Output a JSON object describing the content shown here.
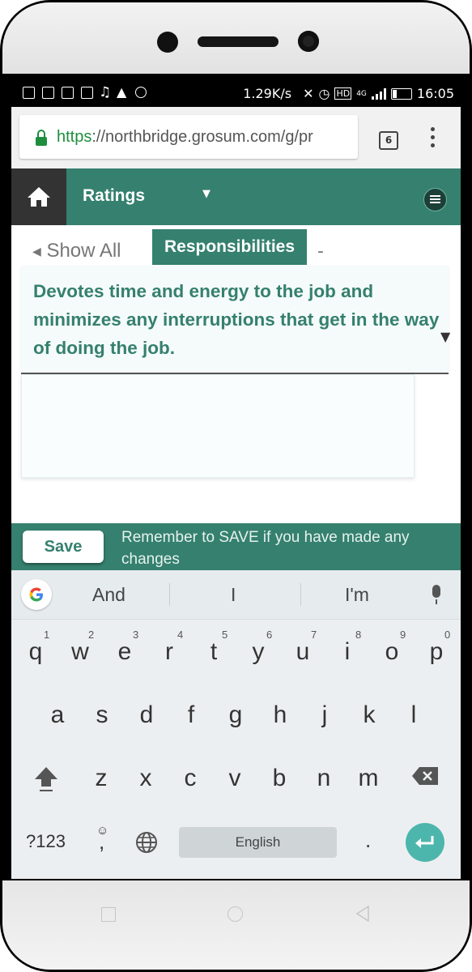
{
  "status_bar": {
    "net_speed": "1.29K/s",
    "network_badge": "4G",
    "time": "16:05"
  },
  "browser": {
    "url_scheme": "https",
    "url_rest": "://northbridge.grosum.com/g/pr",
    "tab_count": "6"
  },
  "nav": {
    "title": "Ratings",
    "dropdown_caret": "▼"
  },
  "content": {
    "show_all": "Show All",
    "category": "Responsibilities",
    "dash": "-",
    "question": "Devotes time and energy to the job and minimizes any interruptions that get in the way of doing the job.",
    "textarea_value": ""
  },
  "save_bar": {
    "save_label": "Save",
    "message": "Remember to SAVE if you have made any changes"
  },
  "keyboard": {
    "suggestions": [
      "And",
      "I",
      "I'm"
    ],
    "row1": [
      "q",
      "w",
      "e",
      "r",
      "t",
      "y",
      "u",
      "i",
      "o",
      "p"
    ],
    "row1_hints": [
      "1",
      "2",
      "3",
      "4",
      "5",
      "6",
      "7",
      "8",
      "9",
      "0"
    ],
    "row2": [
      "a",
      "s",
      "d",
      "f",
      "g",
      "h",
      "j",
      "k",
      "l"
    ],
    "row3": [
      "z",
      "x",
      "c",
      "v",
      "b",
      "n",
      "m"
    ],
    "symbols_label": "?123",
    "comma": ",",
    "period": ".",
    "space_label": "English"
  },
  "colors": {
    "primary": "#35806e",
    "home_bg": "#333333",
    "enter_key": "#4db6ac"
  }
}
